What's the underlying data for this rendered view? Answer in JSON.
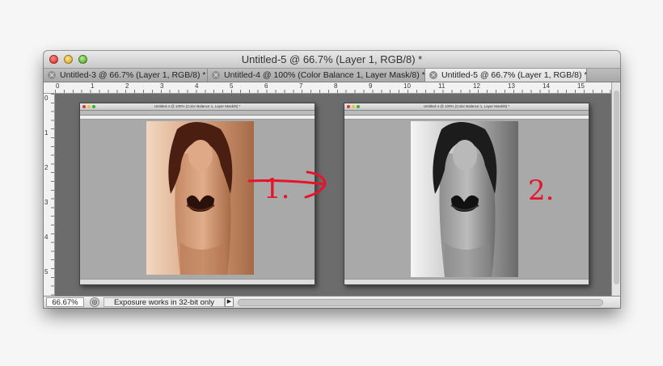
{
  "window": {
    "title": "Untitled-5 @ 66.7% (Layer 1, RGB/8) *"
  },
  "tabs": [
    {
      "label": "Untitled-3 @ 66.7% (Layer 1, RGB/8) *",
      "active": false
    },
    {
      "label": "Untitled-4 @ 100% (Color Balance 1, Layer Mask/8) *",
      "active": false
    },
    {
      "label": "Untitled-5 @ 66.7% (Layer 1, RGB/8) *",
      "active": true
    }
  ],
  "ruler": {
    "top": [
      "0",
      "1",
      "2",
      "3",
      "4",
      "5",
      "6",
      "7",
      "8",
      "9",
      "10",
      "11",
      "12",
      "13",
      "14",
      "15"
    ],
    "left": [
      "0",
      "1",
      "2",
      "3",
      "4",
      "5"
    ]
  },
  "status": {
    "zoom": "66.67%",
    "message": "Exposure works in 32-bit only"
  },
  "annotations": {
    "left": "1.",
    "right": "2."
  },
  "colors": {
    "arrow": "#e8132b",
    "sepia": "#b77a55",
    "canvas": "#6c6c6c"
  },
  "icons": {
    "close": "close-icon",
    "status": "status-icon",
    "menu": "triangle-right-icon"
  }
}
